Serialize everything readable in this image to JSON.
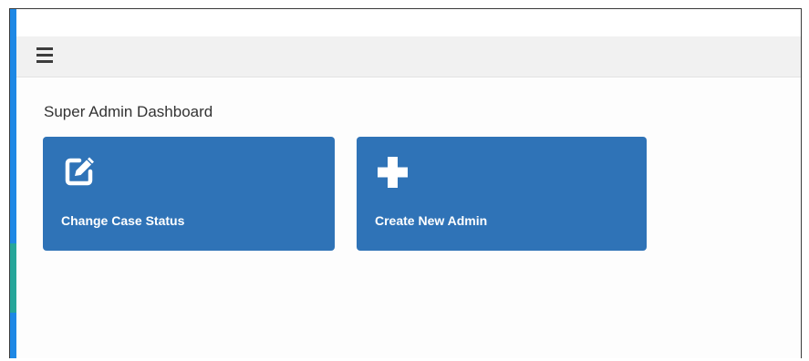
{
  "header": {
    "menu_icon": "hamburger-menu-icon"
  },
  "page": {
    "title": "Super Admin Dashboard"
  },
  "tiles": [
    {
      "label": "Change Case Status",
      "icon": "edit-icon"
    },
    {
      "label": "Create New Admin",
      "icon": "plus-icon"
    }
  ],
  "colors": {
    "accent": "#1e88e5",
    "tile_bg": "#2f73b7",
    "accent_secondary": "#26a69a"
  }
}
